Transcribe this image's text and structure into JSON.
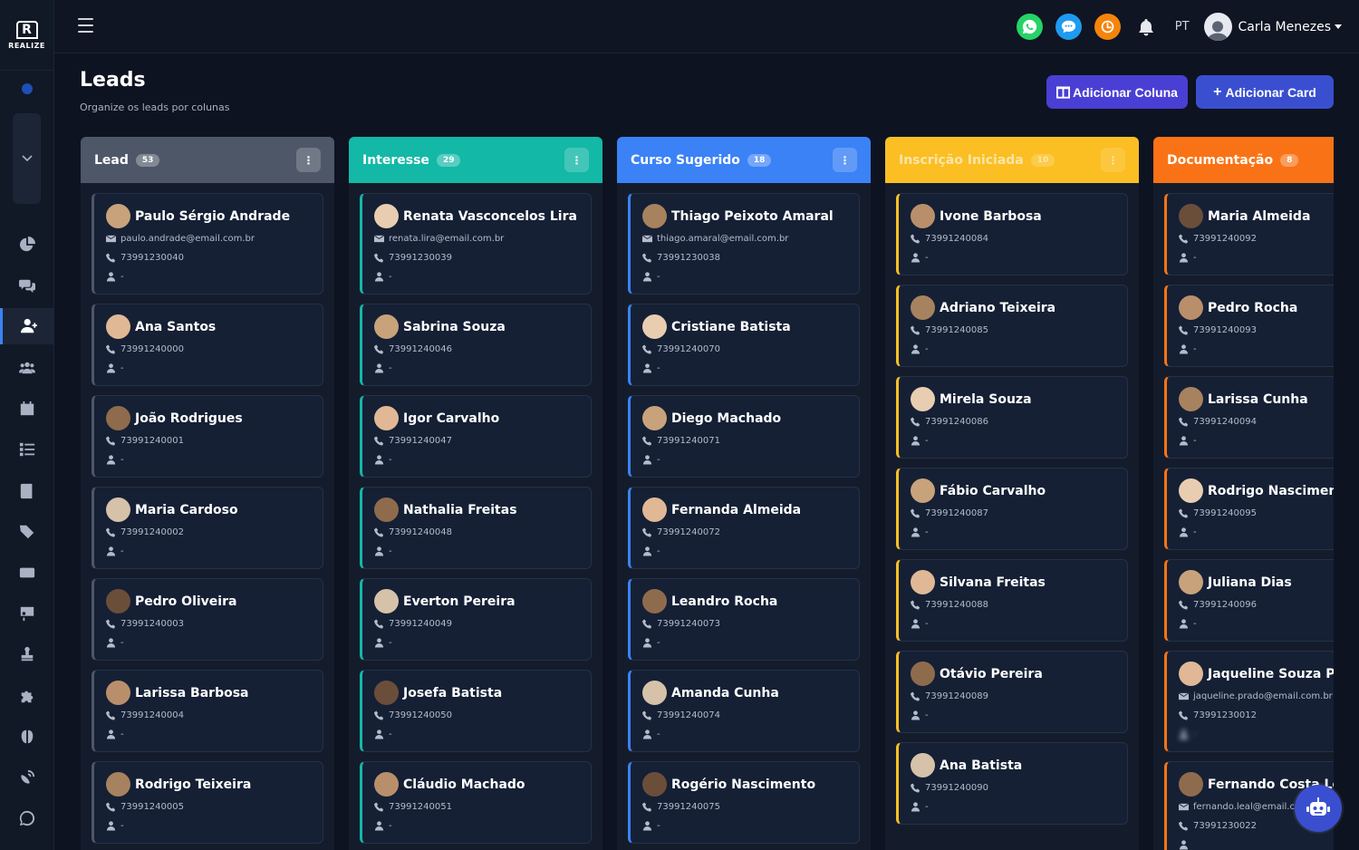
{
  "app": {
    "logo_mark": "R",
    "logo_text": "REALIZE"
  },
  "topbar": {
    "language": "PT",
    "user_name": "Carla Menezes"
  },
  "page": {
    "title": "Leads",
    "subtitle": "Organize os leads por colunas"
  },
  "actions": {
    "add_column": "Adicionar Coluna",
    "add_card": "Adicionar Card"
  },
  "colors": {
    "lead": "#4e5768",
    "interesse": "#14b8a6",
    "curso": "#3b82f6",
    "inscricao": "#fbbf24",
    "documentacao": "#f97316",
    "whatsapp": "#25d366",
    "chat": "#1e9bf0",
    "clock": "#f5840c"
  },
  "icons": {
    "whatsapp": "whatsapp-icon",
    "chat": "chat-icon",
    "clock": "clock-icon",
    "bell": "bell-icon",
    "menu": "kebab-icon",
    "email": "envelope-icon",
    "phone": "phone-icon",
    "owner": "user-icon",
    "bot": "robot-icon"
  },
  "columns": [
    {
      "name": "Lead",
      "count": "53",
      "cards": [
        {
          "name": "Paulo Sérgio Andrade",
          "email": "paulo.andrade@email.com.br",
          "phone": "73991230040",
          "owner": "-"
        },
        {
          "name": "Ana Santos",
          "phone": "73991240000",
          "owner": "-"
        },
        {
          "name": "João Rodrigues",
          "phone": "73991240001",
          "owner": "-"
        },
        {
          "name": "Maria Cardoso",
          "phone": "73991240002",
          "owner": "-"
        },
        {
          "name": "Pedro Oliveira",
          "phone": "73991240003",
          "owner": "-"
        },
        {
          "name": "Larissa Barbosa",
          "phone": "73991240004",
          "owner": "-"
        },
        {
          "name": "Rodrigo Teixeira",
          "phone": "73991240005",
          "owner": "-"
        }
      ]
    },
    {
      "name": "Interesse",
      "count": "29",
      "cards": [
        {
          "name": "Renata Vasconcelos Lira",
          "email": "renata.lira@email.com.br",
          "phone": "73991230039",
          "owner": "-"
        },
        {
          "name": "Sabrina Souza",
          "phone": "73991240046",
          "owner": "-"
        },
        {
          "name": "Igor Carvalho",
          "phone": "73991240047",
          "owner": "-"
        },
        {
          "name": "Nathalia Freitas",
          "phone": "73991240048",
          "owner": "-"
        },
        {
          "name": "Everton Pereira",
          "phone": "73991240049",
          "owner": "-"
        },
        {
          "name": "Josefa Batista",
          "phone": "73991240050",
          "owner": "-"
        },
        {
          "name": "Cláudio Machado",
          "phone": "73991240051",
          "owner": "-"
        }
      ]
    },
    {
      "name": "Curso Sugerido",
      "count": "18",
      "cards": [
        {
          "name": "Thiago Peixoto Amaral",
          "email": "thiago.amaral@email.com.br",
          "phone": "73991230038",
          "owner": "-"
        },
        {
          "name": "Cristiane Batista",
          "phone": "73991240070",
          "owner": "-"
        },
        {
          "name": "Diego Machado",
          "phone": "73991240071",
          "owner": "-"
        },
        {
          "name": "Fernanda Almeida",
          "phone": "73991240072",
          "owner": "-"
        },
        {
          "name": "Leandro Rocha",
          "phone": "73991240073",
          "owner": "-"
        },
        {
          "name": "Amanda Cunha",
          "phone": "73991240074",
          "owner": "-"
        },
        {
          "name": "Rogério Nascimento",
          "phone": "73991240075",
          "owner": "-"
        }
      ]
    },
    {
      "name": "Inscrição Iniciada",
      "count": "10",
      "cards": [
        {
          "name": "Ivone Barbosa",
          "phone": "73991240084",
          "owner": "-"
        },
        {
          "name": "Adriano Teixeira",
          "phone": "73991240085",
          "owner": "-"
        },
        {
          "name": "Mirela Souza",
          "phone": "73991240086",
          "owner": "-"
        },
        {
          "name": "Fábio Carvalho",
          "phone": "73991240087",
          "owner": "-"
        },
        {
          "name": "Silvana Freitas",
          "phone": "73991240088",
          "owner": "-"
        },
        {
          "name": "Otávio Pereira",
          "phone": "73991240089",
          "owner": "-"
        },
        {
          "name": "Ana Batista",
          "phone": "73991240090",
          "owner": "-"
        }
      ]
    },
    {
      "name": "Documentação",
      "count": "8",
      "cards": [
        {
          "name": "Maria Almeida",
          "phone": "73991240092",
          "owner": "-"
        },
        {
          "name": "Pedro Rocha",
          "phone": "73991240093",
          "owner": "-"
        },
        {
          "name": "Larissa Cunha",
          "phone": "73991240094",
          "owner": "-"
        },
        {
          "name": "Rodrigo Nascimento",
          "phone": "73991240095",
          "owner": "-"
        },
        {
          "name": "Juliana Dias",
          "phone": "73991240096",
          "owner": "-"
        },
        {
          "name": "Jaqueline Souza Prado",
          "email": "jaqueline.prado@email.com.br",
          "phone": "73991230012",
          "owner": "-"
        },
        {
          "name": "Fernando Costa Leal",
          "email": "fernando.leal@email.com.br",
          "phone": "73991230022",
          "owner": ""
        }
      ]
    }
  ]
}
